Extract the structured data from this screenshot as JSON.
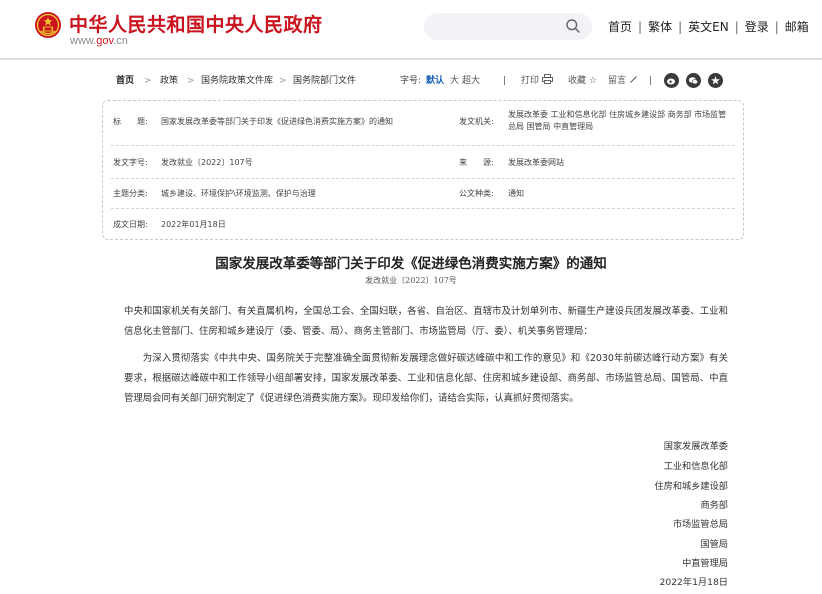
{
  "header": {
    "site_title": "中华人民共和国中央人民政府",
    "domain_prefix": "www.",
    "domain_red": "gov",
    "domain_suffix": ".cn",
    "search_placeholder": "",
    "nav": [
      "首页",
      "繁体",
      "英文EN",
      "登录",
      "邮箱"
    ],
    "separator": "|"
  },
  "breadcrumb": {
    "items": [
      "首页",
      "政策",
      "国务院政策文件库",
      "国务院部门文件"
    ],
    "arrow": ">"
  },
  "toolbar": {
    "font_label": "字号:",
    "font_default": "默认",
    "font_large": "大",
    "font_xlarge": "超大",
    "divider": "|",
    "print": "打印",
    "favorite": "收藏",
    "comment": "留言",
    "share_icons": [
      "weibo-icon",
      "wechat-icon",
      "qzone-icon"
    ]
  },
  "info": {
    "title_label": "标　　题:",
    "title_value": "国家发展改革委等部门关于印发《促进绿色消费实施方案》的通知",
    "issuer_label": "发文机关:",
    "issuer_value": "发展改革委  工业和信息化部  住房城乡建设部  商务部  市场监管总局  国管局  中直管理局",
    "docno_label": "发文字号:",
    "docno_value": "发改就业〔2022〕107号",
    "source_label": "来　　源:",
    "source_value": "发展改革委网站",
    "topic_label": "主题分类:",
    "topic_value": "城乡建设、环境保护\\环境监测、保护与治理",
    "type_label": "公文种类:",
    "type_value": "通知",
    "date_label": "成文日期:",
    "date_value": "2022年01月18日"
  },
  "article": {
    "title": "国家发展改革委等部门关于印发《促进绿色消费实施方案》的通知",
    "doc_number": "发改就业〔2022〕107号",
    "para1": "中央和国家机关有关部门、有关直属机构，全国总工会、全国妇联，各省、自治区、直辖市及计划单列市、新疆生产建设兵团发展改革委、工业和信息化主管部门、住房和城乡建设厅（委、管委、局）、商务主管部门、市场监管局（厅、委）、机关事务管理局：",
    "para2": "为深入贯彻落实《中共中央、国务院关于完整准确全面贯彻新发展理念做好碳达峰碳中和工作的意见》和《2030年前碳达峰行动方案》有关要求，根据碳达峰碳中和工作领导小组部署安排，国家发展改革委、工业和信息化部、住房和城乡建设部、商务部、市场监管总局、国管局、中直管理局会同有关部门研究制定了《促进绿色消费实施方案》。现印发给你们，请结合实际，认真抓好贯彻落实。",
    "signatories": [
      "国家发展改革委",
      "工业和信息化部",
      "住房和城乡建设部",
      "商务部",
      "市场监管总局",
      "国管局",
      "中直管理局"
    ],
    "date": "2022年1月18日"
  },
  "colors": {
    "brand_red": "#c9131e",
    "link_blue": "#1c63b8",
    "search_bg": "#f2f3f7"
  }
}
